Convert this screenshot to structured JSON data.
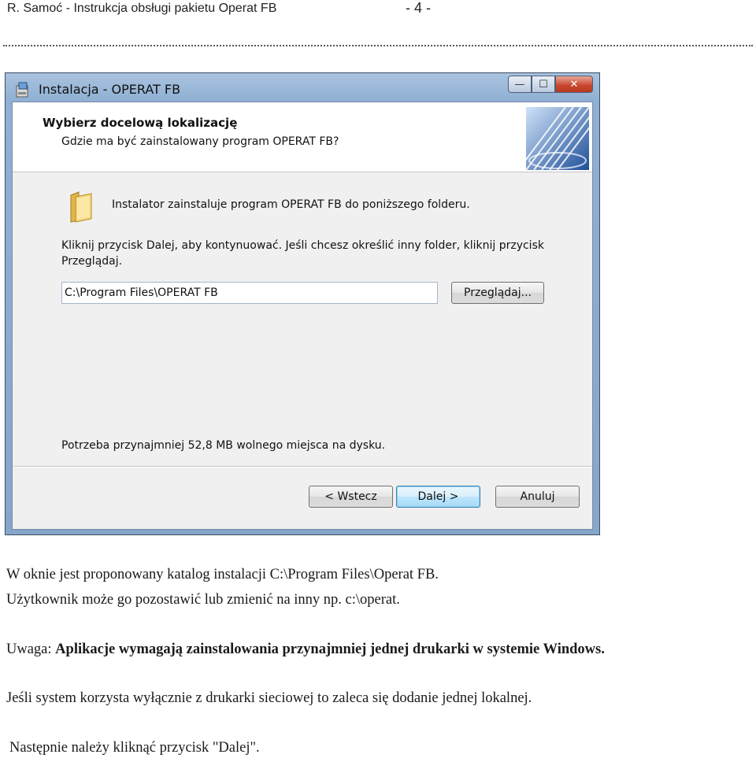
{
  "header": {
    "author_title": "R. Samoć   - Instrukcja obsługi pakietu Operat FB",
    "page_number": "- 4 -"
  },
  "window": {
    "title": "Instalacja - OPERAT FB",
    "controls": {
      "minimize": "—",
      "maximize": "☐",
      "close": "✕"
    },
    "banner": {
      "title": "Wybierz docelową lokalizację",
      "subtitle": "Gdzie ma być zainstalowany program OPERAT FB?"
    },
    "info_folder": "Instalator zainstaluje program OPERAT FB do poniższego folderu.",
    "info_continue": "Kliknij przycisk Dalej, aby kontynuować. Jeśli chcesz określić inny folder, kliknij przycisk Przeglądaj.",
    "path_value": "C:\\Program Files\\OPERAT FB",
    "browse_label": "Przeglądaj...",
    "space_note": "Potrzeba przynajmniej 52,8 MB wolnego miejsca na dysku.",
    "back_label": "< Wstecz",
    "next_label": "Dalej >",
    "cancel_label": "Anuluj"
  },
  "text": {
    "line1": "W oknie jest proponowany katalog instalacji C:\\Program Files\\Operat FB.",
    "line2": "Użytkownik może go pozostawić lub zmienić na inny np. c:\\operat.",
    "note_prefix": "Uwaga: ",
    "note_bold": "Aplikacje wymagają zainstalowania przynajmniej jednej drukarki w systemie Windows.",
    "line4": "Jeśli system korzysta wyłącznie z drukarki sieciowej to zaleca się  dodanie jednej lokalnej.",
    "line5": "Następnie należy kliknąć przycisk \"Dalej\"."
  }
}
